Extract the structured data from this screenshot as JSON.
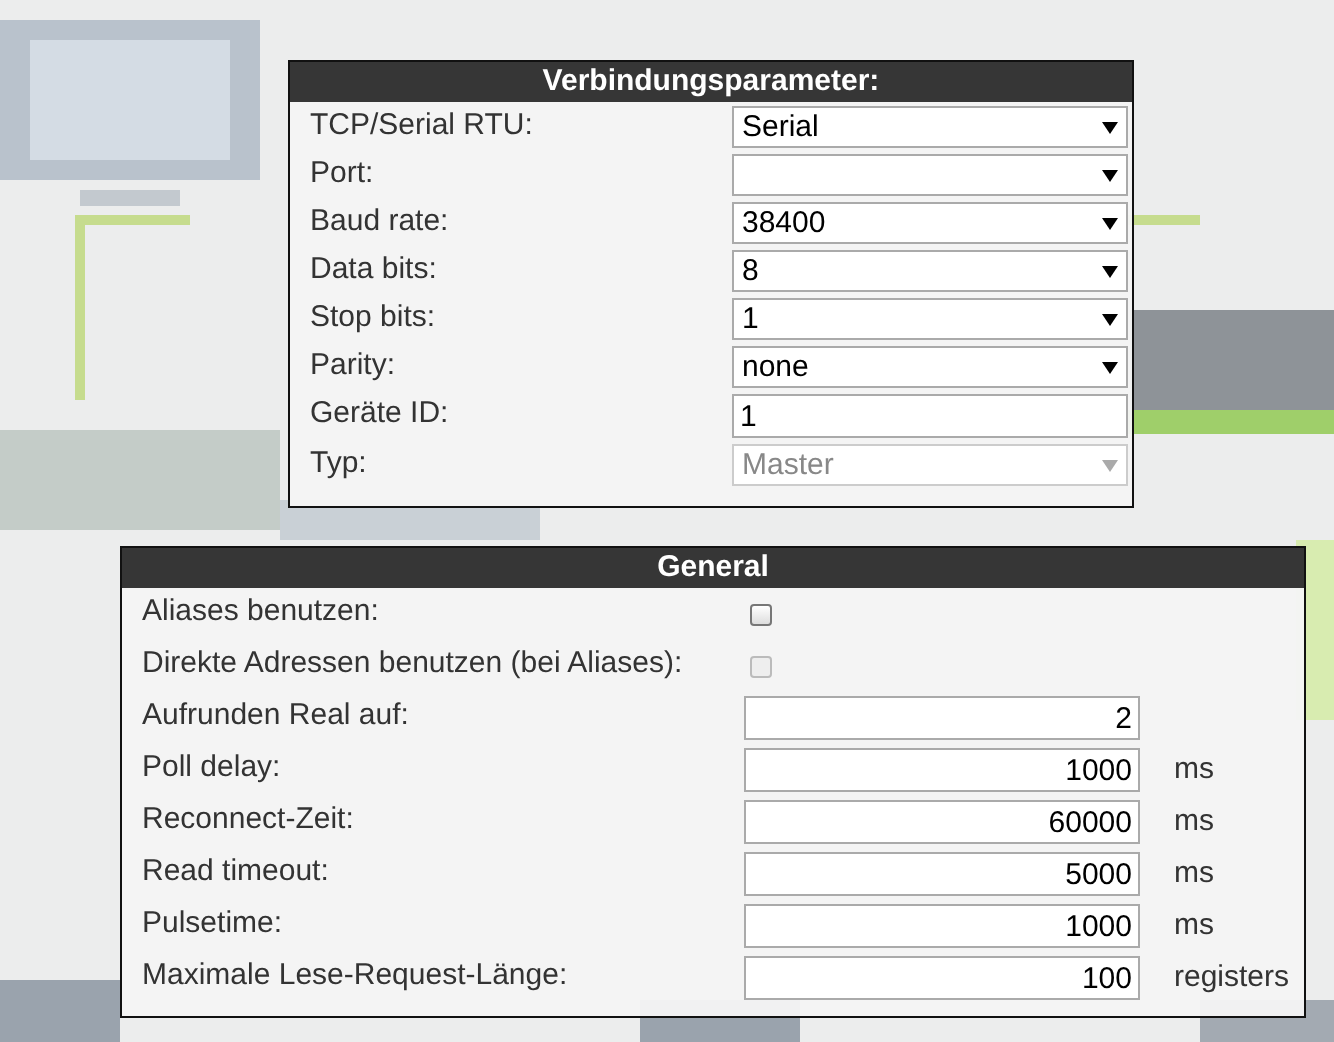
{
  "connection": {
    "title": "Verbindungsparameter:",
    "fields": [
      {
        "label": "TCP/Serial RTU:",
        "kind": "select",
        "value": "Serial",
        "disabled": false
      },
      {
        "label": "Port:",
        "kind": "select",
        "disabled": false
      },
      {
        "label": "Baud rate:",
        "kind": "select",
        "value": "38400",
        "disabled": false
      },
      {
        "label": "Data bits:",
        "kind": "select",
        "value": "8",
        "disabled": false
      },
      {
        "label": "Stop bits:",
        "kind": "select",
        "value": "1",
        "disabled": false
      },
      {
        "label": "Parity:",
        "kind": "select",
        "value": "none",
        "disabled": false
      },
      {
        "label": "Geräte ID:",
        "kind": "input",
        "value": "1",
        "disabled": false
      },
      {
        "label": "Typ:",
        "kind": "select",
        "value": "Master",
        "disabled": true
      }
    ]
  },
  "general": {
    "title": "General",
    "fields": [
      {
        "label": "Aliases benutzen:",
        "kind": "checkbox",
        "checked": false,
        "disabled": false
      },
      {
        "label": "Direkte Adressen benutzen (bei Aliases):",
        "kind": "checkbox",
        "checked": false,
        "disabled": true
      },
      {
        "label": "Aufrunden Real auf:",
        "kind": "number",
        "value": "2"
      },
      {
        "label": "Poll delay:",
        "kind": "number",
        "value": "1000",
        "unit": "ms"
      },
      {
        "label": "Reconnect-Zeit:",
        "kind": "number",
        "value": "60000",
        "unit": "ms"
      },
      {
        "label": "Read timeout:",
        "kind": "number",
        "value": "5000",
        "unit": "ms"
      },
      {
        "label": "Pulsetime:",
        "kind": "number",
        "value": "1000",
        "unit": "ms"
      },
      {
        "label": "Maximale Lese-Request-Länge:",
        "kind": "number",
        "value": "100",
        "unit": "registers"
      }
    ]
  }
}
